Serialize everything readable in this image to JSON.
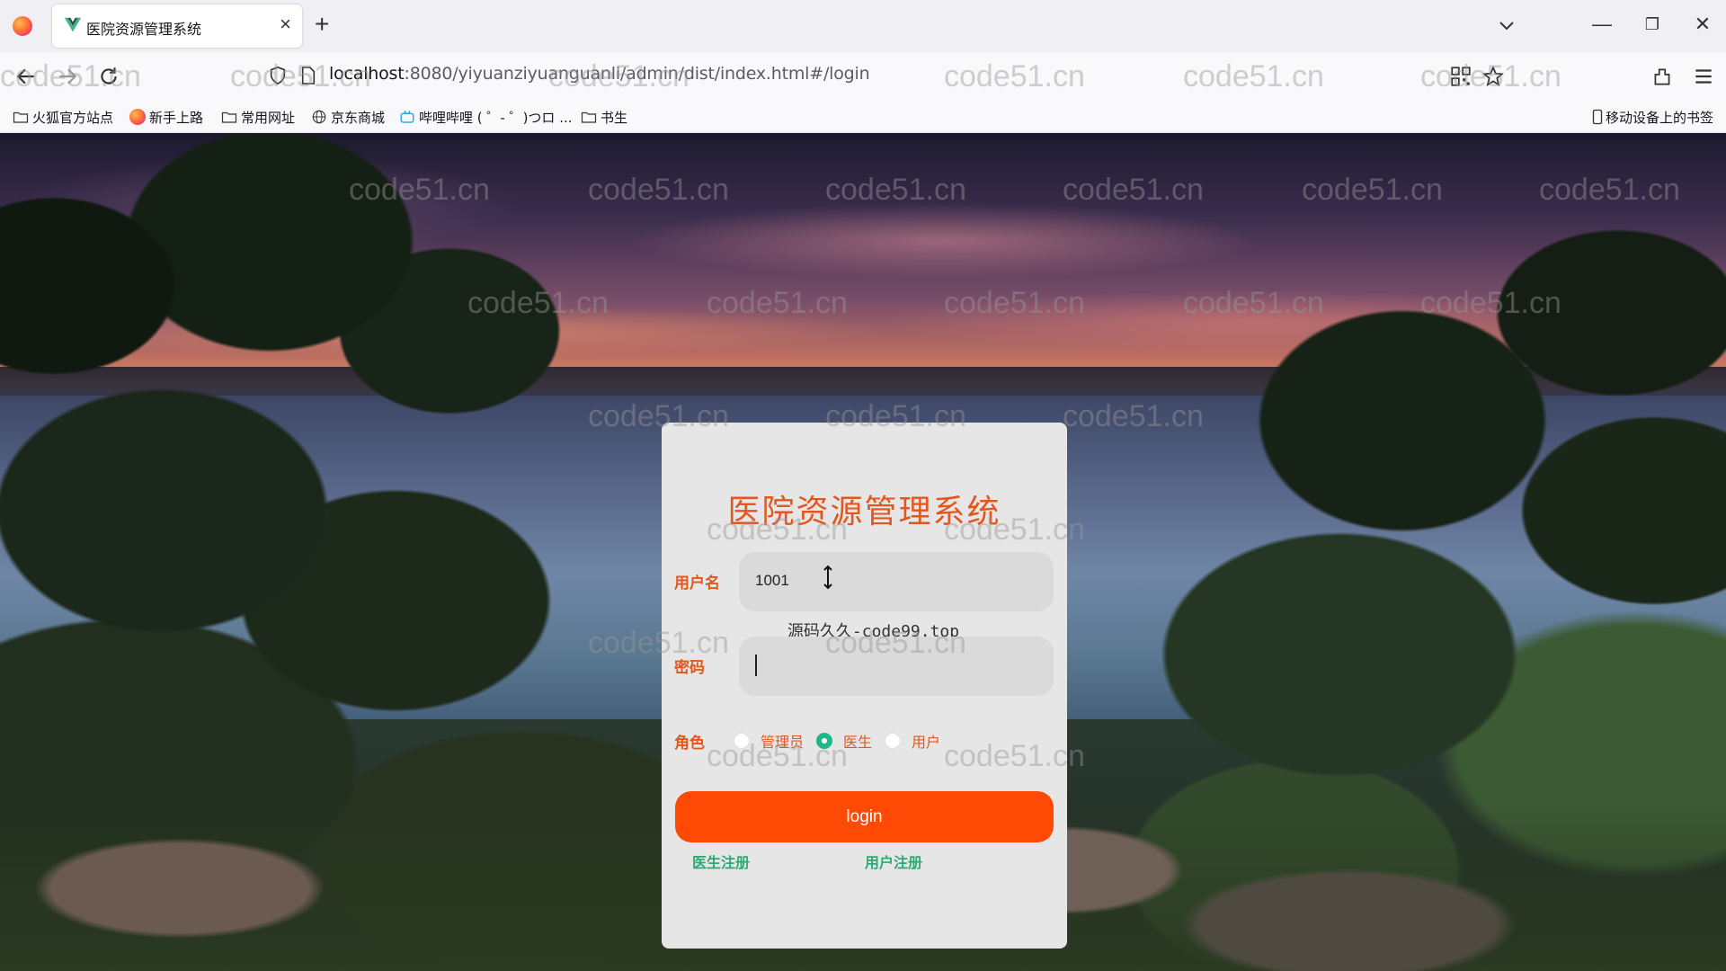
{
  "browser": {
    "tab_title": "医院资源管理系统",
    "tab_close": "×",
    "new_tab": "+",
    "url_host": "localhost",
    "url_path": ":8080/yiyuanziyuanguanli/admin/dist/index.html#/login",
    "bookmarks": [
      {
        "label": "火狐官方站点",
        "icon": "folder-icon"
      },
      {
        "label": "新手上路",
        "icon": "firefox-icon"
      },
      {
        "label": "常用网址",
        "icon": "folder-icon"
      },
      {
        "label": "京东商城",
        "icon": "globe-icon"
      },
      {
        "label": "哔哩哔哩 ( ゜- ゜)つロ ...",
        "icon": "bilibili-icon"
      },
      {
        "label": "书生",
        "icon": "folder-icon"
      }
    ],
    "mobile_bookmarks": "移动设备上的书签",
    "window_controls": {
      "minimize": "—",
      "restore": "❐",
      "close": "✕"
    }
  },
  "login": {
    "title": "医院资源管理系统",
    "username_label": "用户名",
    "username_value": "1001",
    "password_label": "密码",
    "password_value": "",
    "overlay_text": "源码久久-code99.top",
    "role_label": "角色",
    "roles": [
      {
        "label": "管理员",
        "checked": false
      },
      {
        "label": "医生",
        "checked": true
      },
      {
        "label": "用户",
        "checked": false
      }
    ],
    "login_button": "login",
    "doctor_register": "医生注册",
    "user_register": "用户注册"
  },
  "watermark": "code51.cn",
  "colors": {
    "accent": "#e2571e",
    "button": "#ff4a05",
    "link": "#30a876",
    "radio_checked": "#20b88a",
    "panel": "#e6e6e6"
  }
}
